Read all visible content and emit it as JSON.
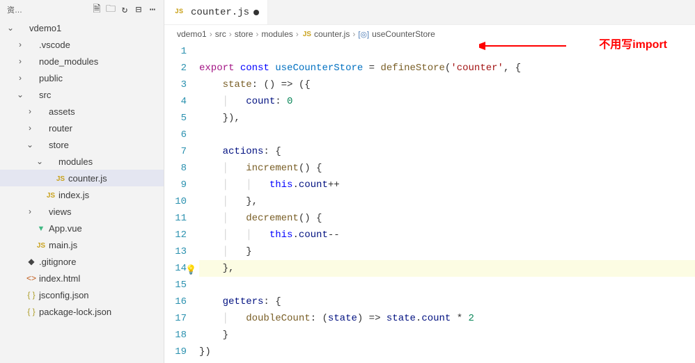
{
  "sidebar": {
    "title": "资…",
    "root": "vdemo1",
    "tree": [
      {
        "depth": 0,
        "kind": "folder-open",
        "label": "vdemo1"
      },
      {
        "depth": 1,
        "kind": "folder",
        "label": ".vscode"
      },
      {
        "depth": 1,
        "kind": "folder",
        "label": "node_modules"
      },
      {
        "depth": 1,
        "kind": "folder",
        "label": "public"
      },
      {
        "depth": 1,
        "kind": "folder-open",
        "label": "src"
      },
      {
        "depth": 2,
        "kind": "folder",
        "label": "assets"
      },
      {
        "depth": 2,
        "kind": "folder",
        "label": "router"
      },
      {
        "depth": 2,
        "kind": "folder-open",
        "label": "store"
      },
      {
        "depth": 3,
        "kind": "folder-open",
        "label": "modules"
      },
      {
        "depth": 4,
        "kind": "js",
        "label": "counter.js",
        "selected": true
      },
      {
        "depth": 3,
        "kind": "js",
        "label": "index.js"
      },
      {
        "depth": 2,
        "kind": "folder",
        "label": "views"
      },
      {
        "depth": 2,
        "kind": "vue",
        "label": "App.vue"
      },
      {
        "depth": 2,
        "kind": "js",
        "label": "main.js"
      },
      {
        "depth": 1,
        "kind": "git",
        "label": ".gitignore"
      },
      {
        "depth": 1,
        "kind": "html",
        "label": "index.html"
      },
      {
        "depth": 1,
        "kind": "json",
        "label": "jsconfig.json"
      },
      {
        "depth": 1,
        "kind": "json",
        "label": "package-lock.json"
      }
    ]
  },
  "tab": {
    "label": "counter.js",
    "dirty": true
  },
  "breadcrumbs": [
    "vdemo1",
    "src",
    "store",
    "modules",
    "counter.js",
    "useCounterStore"
  ],
  "annotation": "不用写import",
  "code": {
    "lines": 19,
    "highlight_line": 14,
    "tokens": {
      "l2": {
        "export": "export",
        "const": "const",
        "name": "useCounterStore",
        "eq": " = ",
        "fn": "defineStore",
        "paren": "(",
        "str": "'counter'",
        "comma": ", {"
      },
      "l3": {
        "prop": "state",
        "rest": ": () => ({"
      },
      "l4": {
        "prop": "count",
        "rest": ": ",
        "num": "0"
      },
      "l5": {
        "txt": "}),"
      },
      "l7": {
        "prop": "actions",
        "rest": ": {"
      },
      "l8": {
        "fn": "increment",
        "rest": "() {"
      },
      "l9": {
        "this": "this",
        "rest": ".",
        "prop": "count",
        "op": "++"
      },
      "l10": {
        "txt": "},"
      },
      "l11": {
        "fn": "decrement",
        "rest": "() {"
      },
      "l12": {
        "this": "this",
        "rest": ".",
        "prop": "count",
        "op": "--"
      },
      "l13": {
        "txt": "}"
      },
      "l14": {
        "txt": "},"
      },
      "l16": {
        "prop": "getters",
        "rest": ": {"
      },
      "l17": {
        "fn": "doubleCount",
        "rest": ": (",
        "arg": "state",
        "rest2": ") => ",
        "arg2": "state",
        "rest3": ".",
        "prop": "count",
        "rest4": " * ",
        "num": "2"
      },
      "l18": {
        "txt": "}"
      },
      "l19": {
        "txt": "})"
      }
    }
  }
}
